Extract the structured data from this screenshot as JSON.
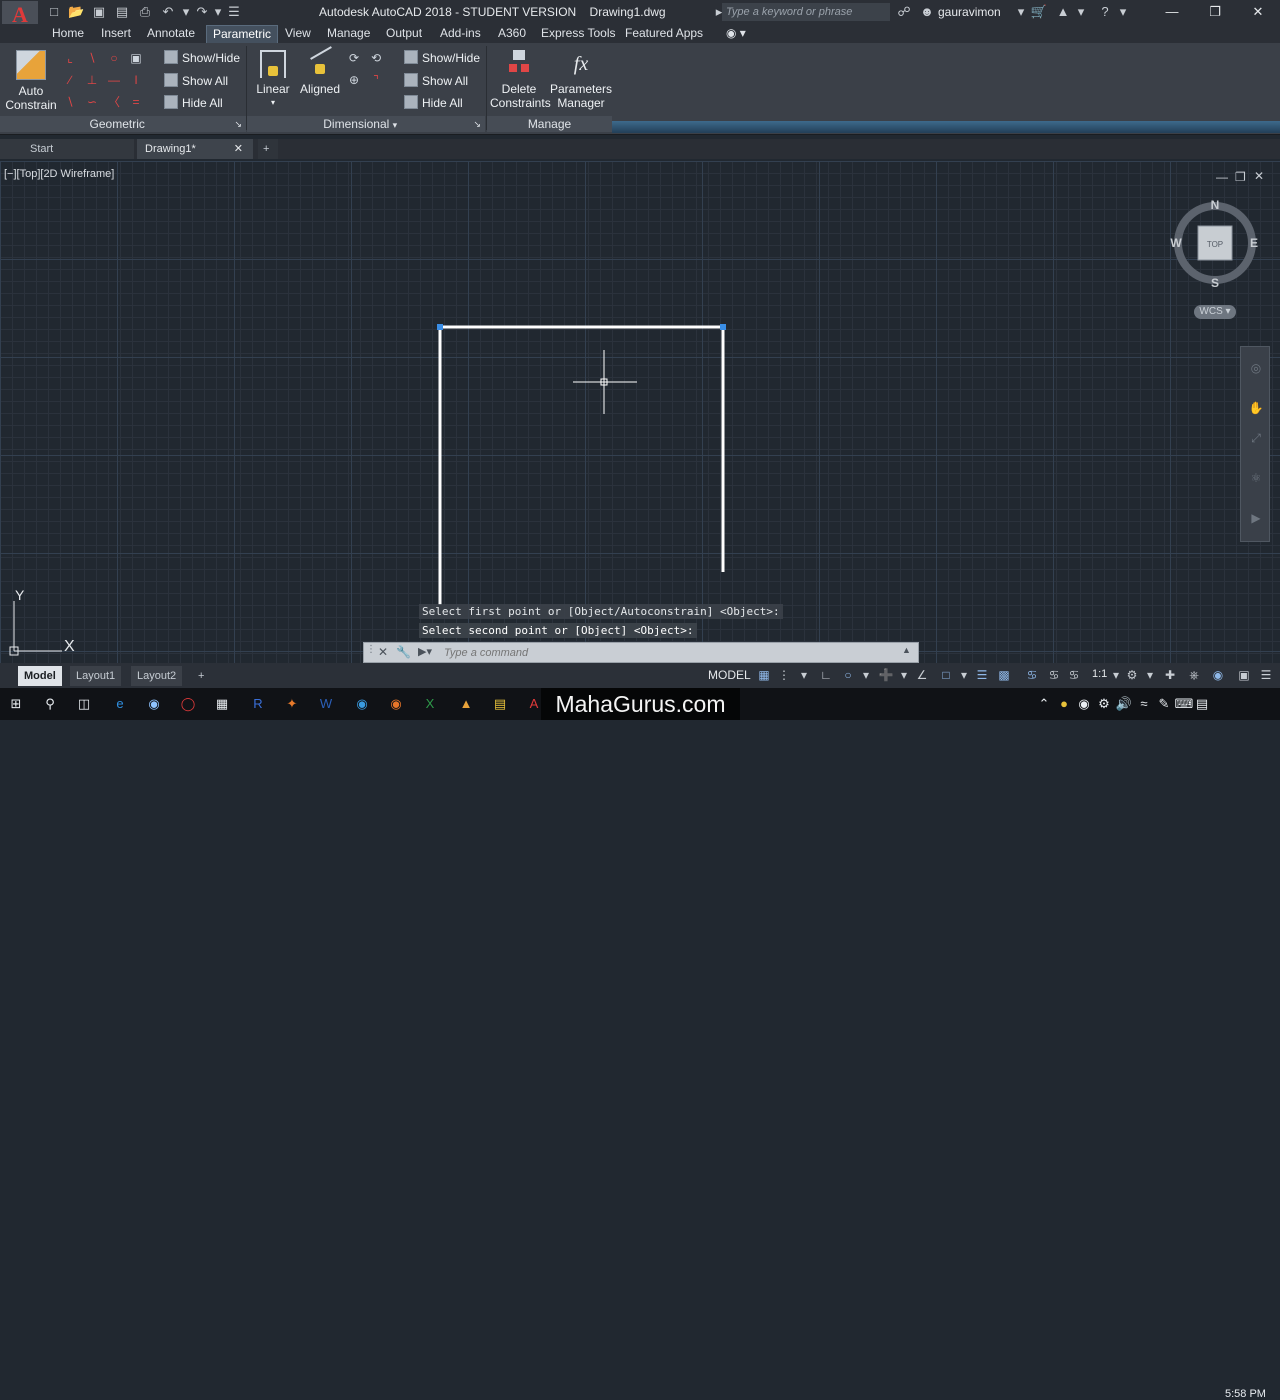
{
  "app": {
    "logo_letter": "A",
    "window_title": "Autodesk AutoCAD 2018 - STUDENT VERSION    Drawing1.dwg",
    "search_placeholder": "Type a keyword or phrase",
    "user_name": "gauravimon"
  },
  "ribbon_tabs": [
    "Home",
    "Insert",
    "Annotate",
    "Parametric",
    "View",
    "Manage",
    "Output",
    "Add-ins",
    "A360",
    "Express Tools",
    "Featured Apps"
  ],
  "active_tab": "Parametric",
  "ribbon": {
    "geometric": {
      "auto_constrain_label_1": "Auto",
      "auto_constrain_label_2": "Constrain",
      "show_hide": "Show/Hide",
      "show_all": "Show All",
      "hide_all": "Hide All",
      "panel_title": "Geometric"
    },
    "dimensional": {
      "linear": "Linear",
      "aligned": "Aligned",
      "show_hide": "Show/Hide",
      "show_all": "Show All",
      "hide_all": "Hide All",
      "panel_title": "Dimensional"
    },
    "manage": {
      "delete_1": "Delete",
      "delete_2": "Constraints",
      "params_1": "Parameters",
      "params_2": "Manager",
      "panel_title": "Manage"
    }
  },
  "doc_tabs": [
    "Start",
    "Drawing1*"
  ],
  "active_doc_tab": "Drawing1*",
  "viewport": {
    "label": "[−][Top][2D Wireframe]",
    "viewcube": {
      "n": "N",
      "s": "S",
      "e": "E",
      "w": "W",
      "face": "TOP"
    },
    "wcs": "WCS",
    "ucs_x": "X",
    "ucs_y": "Y"
  },
  "command": {
    "history": [
      "Select first point or [Object/Autoconstrain] <Object>:",
      "Select second point or [Object] <Object>:"
    ],
    "placeholder": "Type a command"
  },
  "layout_tabs": [
    "Model",
    "Layout1",
    "Layout2"
  ],
  "active_layout": "Model",
  "status": {
    "model": "MODEL",
    "scale": "1:1"
  },
  "taskbar": {
    "watermark": "MahaGurus.com",
    "time": "5:58 PM"
  },
  "colors": {
    "canvas_bg": "#212830",
    "accent_blue": "#3d6a8c",
    "logo_red": "#e03a3a"
  }
}
